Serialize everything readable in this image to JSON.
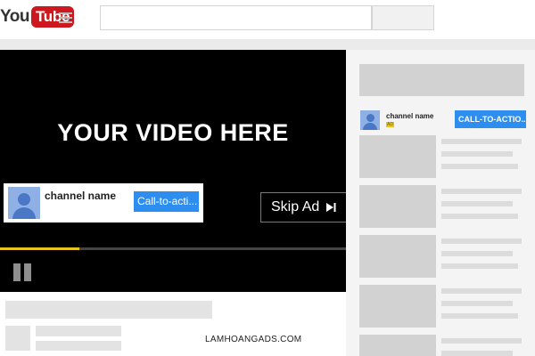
{
  "header": {
    "logo_you": "You",
    "logo_tube": "Tube",
    "search": {
      "placeholder": ""
    }
  },
  "player": {
    "title": "YOUR VIDEO HERE",
    "ad": {
      "channel_name": "channel name",
      "cta_label": "Call-to-acti..."
    },
    "skip_label": "Skip Ad",
    "progress_fraction": 0.23,
    "colors": {
      "progress": "#e8c21f",
      "cta": "#2d8ef0",
      "background": "#000000"
    }
  },
  "sidebar": {
    "ad": {
      "channel_name": "channel name",
      "badge": "AD",
      "cta_label": "CALL-TO-ACTIO..."
    },
    "related_count": 5
  },
  "watermark": "LAMHOANGADS.COM",
  "icons": [
    "youtube-logo",
    "guide-menu-icon",
    "avatar-icon",
    "skip-icon",
    "pause-icon"
  ]
}
